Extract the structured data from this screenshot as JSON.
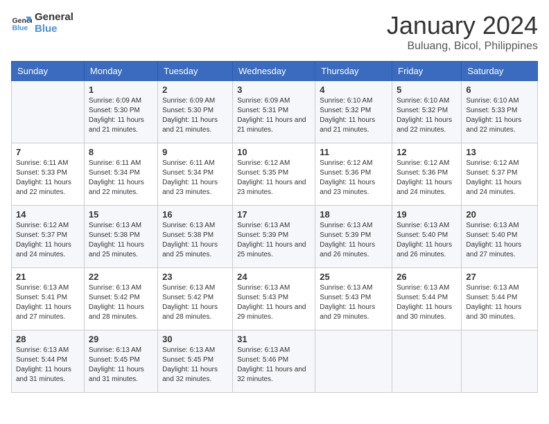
{
  "logo": {
    "line1": "General",
    "line2": "Blue"
  },
  "title": "January 2024",
  "location": "Buluang, Bicol, Philippines",
  "days_of_week": [
    "Sunday",
    "Monday",
    "Tuesday",
    "Wednesday",
    "Thursday",
    "Friday",
    "Saturday"
  ],
  "weeks": [
    [
      {
        "day": "",
        "sunrise": "",
        "sunset": "",
        "daylight": ""
      },
      {
        "day": "1",
        "sunrise": "Sunrise: 6:09 AM",
        "sunset": "Sunset: 5:30 PM",
        "daylight": "Daylight: 11 hours and 21 minutes."
      },
      {
        "day": "2",
        "sunrise": "Sunrise: 6:09 AM",
        "sunset": "Sunset: 5:30 PM",
        "daylight": "Daylight: 11 hours and 21 minutes."
      },
      {
        "day": "3",
        "sunrise": "Sunrise: 6:09 AM",
        "sunset": "Sunset: 5:31 PM",
        "daylight": "Daylight: 11 hours and 21 minutes."
      },
      {
        "day": "4",
        "sunrise": "Sunrise: 6:10 AM",
        "sunset": "Sunset: 5:32 PM",
        "daylight": "Daylight: 11 hours and 21 minutes."
      },
      {
        "day": "5",
        "sunrise": "Sunrise: 6:10 AM",
        "sunset": "Sunset: 5:32 PM",
        "daylight": "Daylight: 11 hours and 22 minutes."
      },
      {
        "day": "6",
        "sunrise": "Sunrise: 6:10 AM",
        "sunset": "Sunset: 5:33 PM",
        "daylight": "Daylight: 11 hours and 22 minutes."
      }
    ],
    [
      {
        "day": "7",
        "sunrise": "Sunrise: 6:11 AM",
        "sunset": "Sunset: 5:33 PM",
        "daylight": "Daylight: 11 hours and 22 minutes."
      },
      {
        "day": "8",
        "sunrise": "Sunrise: 6:11 AM",
        "sunset": "Sunset: 5:34 PM",
        "daylight": "Daylight: 11 hours and 22 minutes."
      },
      {
        "day": "9",
        "sunrise": "Sunrise: 6:11 AM",
        "sunset": "Sunset: 5:34 PM",
        "daylight": "Daylight: 11 hours and 23 minutes."
      },
      {
        "day": "10",
        "sunrise": "Sunrise: 6:12 AM",
        "sunset": "Sunset: 5:35 PM",
        "daylight": "Daylight: 11 hours and 23 minutes."
      },
      {
        "day": "11",
        "sunrise": "Sunrise: 6:12 AM",
        "sunset": "Sunset: 5:36 PM",
        "daylight": "Daylight: 11 hours and 23 minutes."
      },
      {
        "day": "12",
        "sunrise": "Sunrise: 6:12 AM",
        "sunset": "Sunset: 5:36 PM",
        "daylight": "Daylight: 11 hours and 24 minutes."
      },
      {
        "day": "13",
        "sunrise": "Sunrise: 6:12 AM",
        "sunset": "Sunset: 5:37 PM",
        "daylight": "Daylight: 11 hours and 24 minutes."
      }
    ],
    [
      {
        "day": "14",
        "sunrise": "Sunrise: 6:12 AM",
        "sunset": "Sunset: 5:37 PM",
        "daylight": "Daylight: 11 hours and 24 minutes."
      },
      {
        "day": "15",
        "sunrise": "Sunrise: 6:13 AM",
        "sunset": "Sunset: 5:38 PM",
        "daylight": "Daylight: 11 hours and 25 minutes."
      },
      {
        "day": "16",
        "sunrise": "Sunrise: 6:13 AM",
        "sunset": "Sunset: 5:38 PM",
        "daylight": "Daylight: 11 hours and 25 minutes."
      },
      {
        "day": "17",
        "sunrise": "Sunrise: 6:13 AM",
        "sunset": "Sunset: 5:39 PM",
        "daylight": "Daylight: 11 hours and 25 minutes."
      },
      {
        "day": "18",
        "sunrise": "Sunrise: 6:13 AM",
        "sunset": "Sunset: 5:39 PM",
        "daylight": "Daylight: 11 hours and 26 minutes."
      },
      {
        "day": "19",
        "sunrise": "Sunrise: 6:13 AM",
        "sunset": "Sunset: 5:40 PM",
        "daylight": "Daylight: 11 hours and 26 minutes."
      },
      {
        "day": "20",
        "sunrise": "Sunrise: 6:13 AM",
        "sunset": "Sunset: 5:40 PM",
        "daylight": "Daylight: 11 hours and 27 minutes."
      }
    ],
    [
      {
        "day": "21",
        "sunrise": "Sunrise: 6:13 AM",
        "sunset": "Sunset: 5:41 PM",
        "daylight": "Daylight: 11 hours and 27 minutes."
      },
      {
        "day": "22",
        "sunrise": "Sunrise: 6:13 AM",
        "sunset": "Sunset: 5:42 PM",
        "daylight": "Daylight: 11 hours and 28 minutes."
      },
      {
        "day": "23",
        "sunrise": "Sunrise: 6:13 AM",
        "sunset": "Sunset: 5:42 PM",
        "daylight": "Daylight: 11 hours and 28 minutes."
      },
      {
        "day": "24",
        "sunrise": "Sunrise: 6:13 AM",
        "sunset": "Sunset: 5:43 PM",
        "daylight": "Daylight: 11 hours and 29 minutes."
      },
      {
        "day": "25",
        "sunrise": "Sunrise: 6:13 AM",
        "sunset": "Sunset: 5:43 PM",
        "daylight": "Daylight: 11 hours and 29 minutes."
      },
      {
        "day": "26",
        "sunrise": "Sunrise: 6:13 AM",
        "sunset": "Sunset: 5:44 PM",
        "daylight": "Daylight: 11 hours and 30 minutes."
      },
      {
        "day": "27",
        "sunrise": "Sunrise: 6:13 AM",
        "sunset": "Sunset: 5:44 PM",
        "daylight": "Daylight: 11 hours and 30 minutes."
      }
    ],
    [
      {
        "day": "28",
        "sunrise": "Sunrise: 6:13 AM",
        "sunset": "Sunset: 5:44 PM",
        "daylight": "Daylight: 11 hours and 31 minutes."
      },
      {
        "day": "29",
        "sunrise": "Sunrise: 6:13 AM",
        "sunset": "Sunset: 5:45 PM",
        "daylight": "Daylight: 11 hours and 31 minutes."
      },
      {
        "day": "30",
        "sunrise": "Sunrise: 6:13 AM",
        "sunset": "Sunset: 5:45 PM",
        "daylight": "Daylight: 11 hours and 32 minutes."
      },
      {
        "day": "31",
        "sunrise": "Sunrise: 6:13 AM",
        "sunset": "Sunset: 5:46 PM",
        "daylight": "Daylight: 11 hours and 32 minutes."
      },
      {
        "day": "",
        "sunrise": "",
        "sunset": "",
        "daylight": ""
      },
      {
        "day": "",
        "sunrise": "",
        "sunset": "",
        "daylight": ""
      },
      {
        "day": "",
        "sunrise": "",
        "sunset": "",
        "daylight": ""
      }
    ]
  ]
}
